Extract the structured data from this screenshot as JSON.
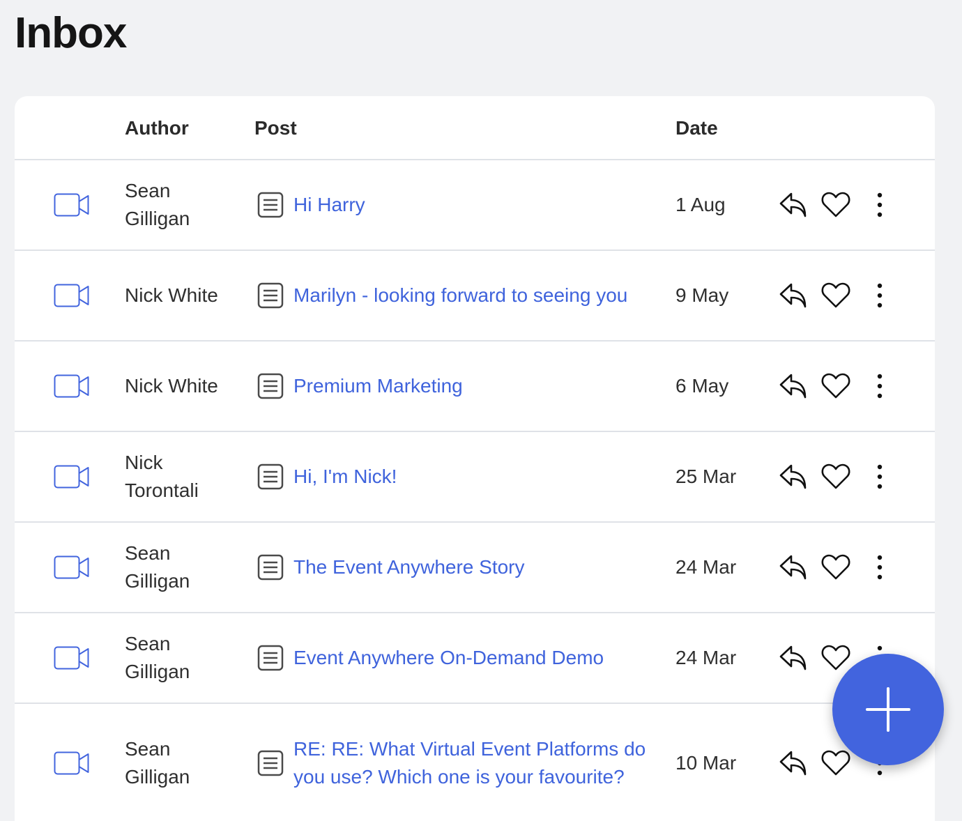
{
  "page": {
    "title": "Inbox"
  },
  "table": {
    "columns": {
      "type": "",
      "author": "Author",
      "post": "Post",
      "date": "Date"
    },
    "rows": [
      {
        "type_icon": "video-camera-icon",
        "author": "Sean Gilligan",
        "post_icon": "document-icon",
        "post": "Hi Harry",
        "date": "1 Aug"
      },
      {
        "type_icon": "video-camera-icon",
        "author": "Nick White",
        "post_icon": "document-icon",
        "post": "Marilyn - looking forward to seeing you",
        "date": "9 May"
      },
      {
        "type_icon": "video-camera-icon",
        "author": "Nick White",
        "post_icon": "document-icon",
        "post": "Premium Marketing",
        "date": "6 May"
      },
      {
        "type_icon": "video-camera-icon",
        "author": "Nick Torontali",
        "post_icon": "document-icon",
        "post": "Hi, I'm Nick!",
        "date": "25 Mar"
      },
      {
        "type_icon": "video-camera-icon",
        "author": "Sean Gilligan",
        "post_icon": "document-icon",
        "post": "The Event Anywhere Story",
        "date": "24 Mar"
      },
      {
        "type_icon": "video-camera-icon",
        "author": "Sean Gilligan",
        "post_icon": "document-icon",
        "post": "Event Anywhere On-Demand Demo",
        "date": "24 Mar"
      },
      {
        "type_icon": "video-camera-icon",
        "author": "Sean Gilligan",
        "post_icon": "document-icon",
        "post": "RE: RE: What Virtual Event Platforms do you use? Which one is your favourite?",
        "date": "10 Mar"
      }
    ],
    "row_actions": [
      "reply-icon",
      "heart-icon",
      "more-vertical-icon"
    ]
  },
  "fab": {
    "icon": "plus-icon"
  },
  "colors": {
    "accent": "#4264de",
    "link": "#3f63dc",
    "background": "#f1f2f4"
  }
}
